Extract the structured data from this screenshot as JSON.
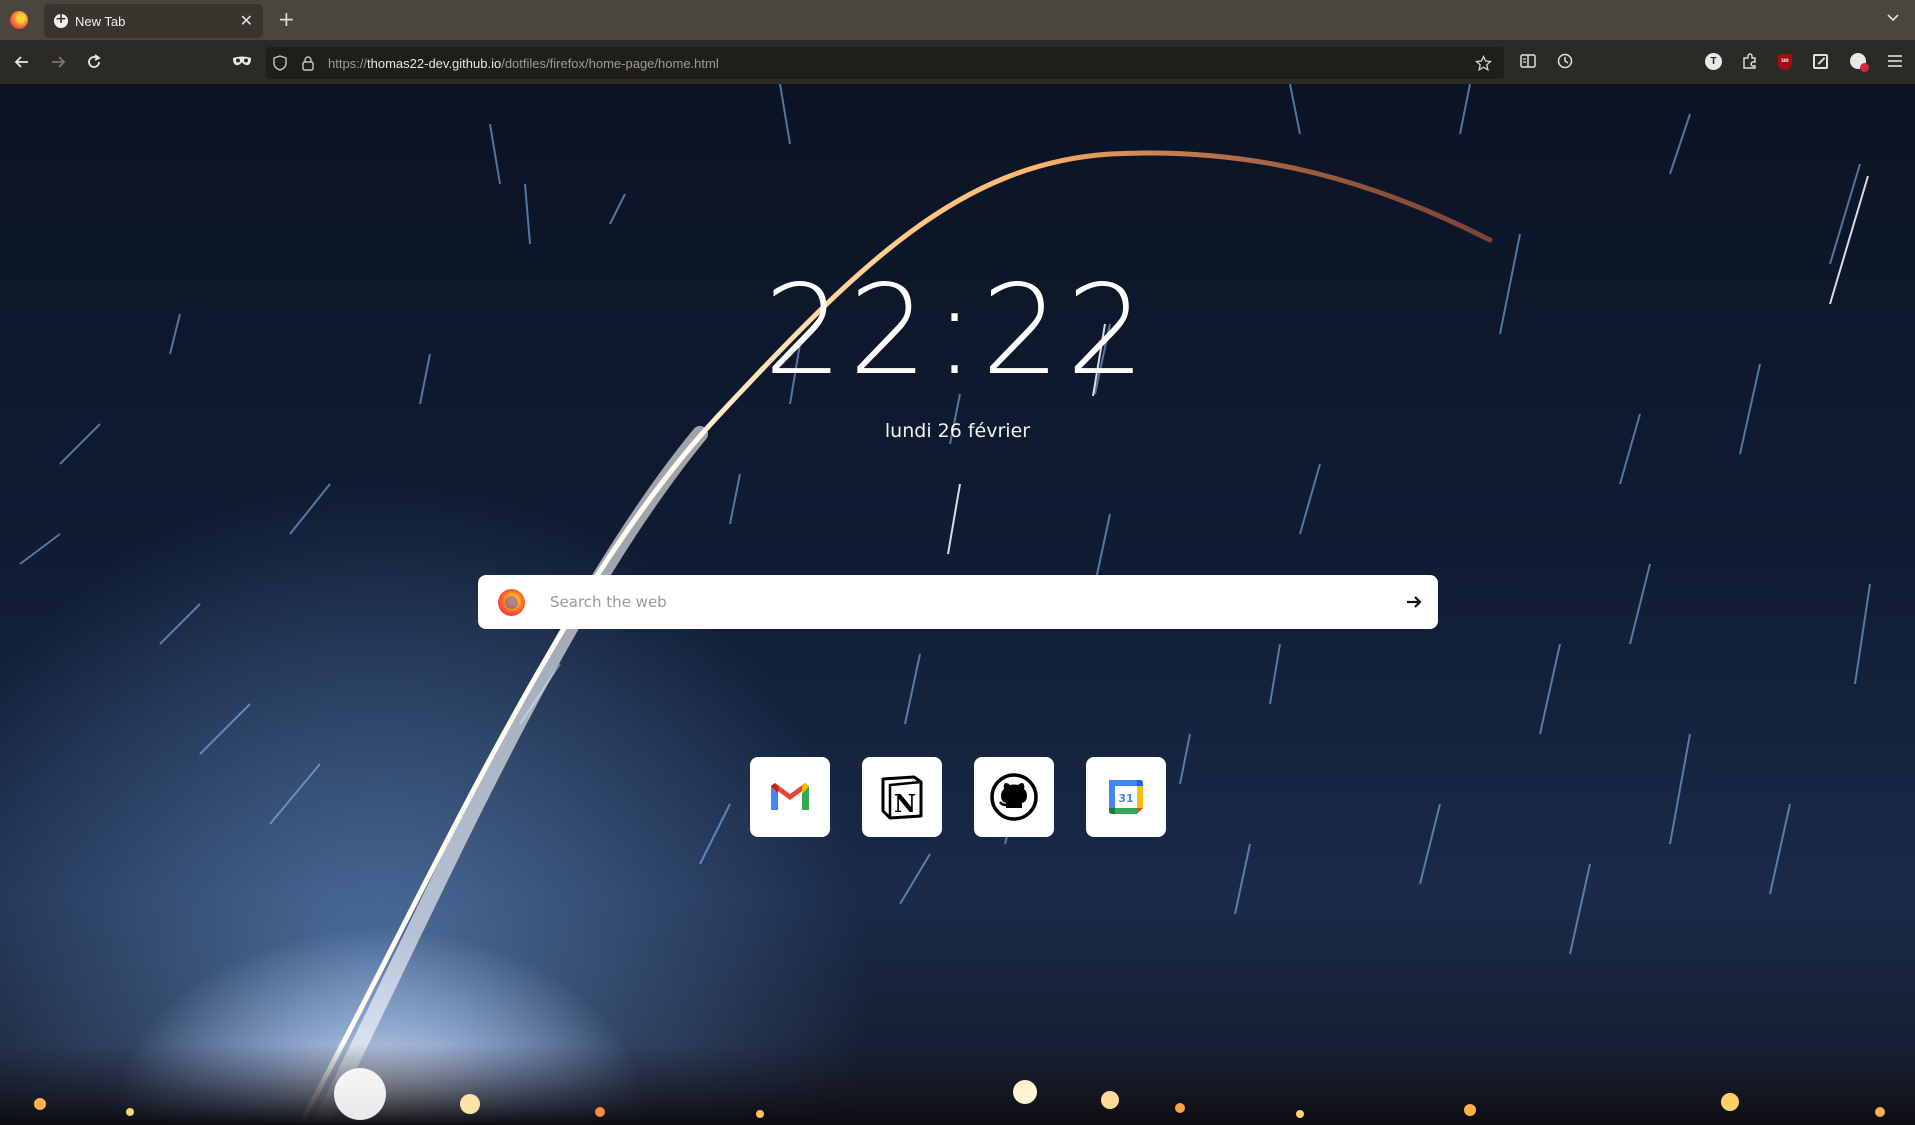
{
  "browser": {
    "tab": {
      "title": "New Tab"
    },
    "url": {
      "prefix": "https://",
      "host": "thomas22-dev.github.io",
      "path": "/dotfiles/firefox/home-page/home.html"
    },
    "extensions": {
      "translate_badge": "T",
      "ublock_badge": "uo"
    }
  },
  "page": {
    "time": "22:22",
    "date": "lundi 26 février",
    "search": {
      "placeholder": "Search the web"
    },
    "shortcuts": [
      {
        "name": "Gmail",
        "icon": "gmail-icon"
      },
      {
        "name": "Notion",
        "icon": "notion-icon"
      },
      {
        "name": "GitHub",
        "icon": "github-icon"
      },
      {
        "name": "Google Calendar",
        "icon": "google-calendar-icon",
        "label": "31"
      }
    ]
  },
  "colors": {
    "tabstrip": "#4a463e",
    "navbar": "#2c2a25",
    "urlbar": "#1f1e1b",
    "rocket_trail": "#ffb86b",
    "gmail_red": "#ea4335",
    "calendar_blue": "#4285f4"
  }
}
